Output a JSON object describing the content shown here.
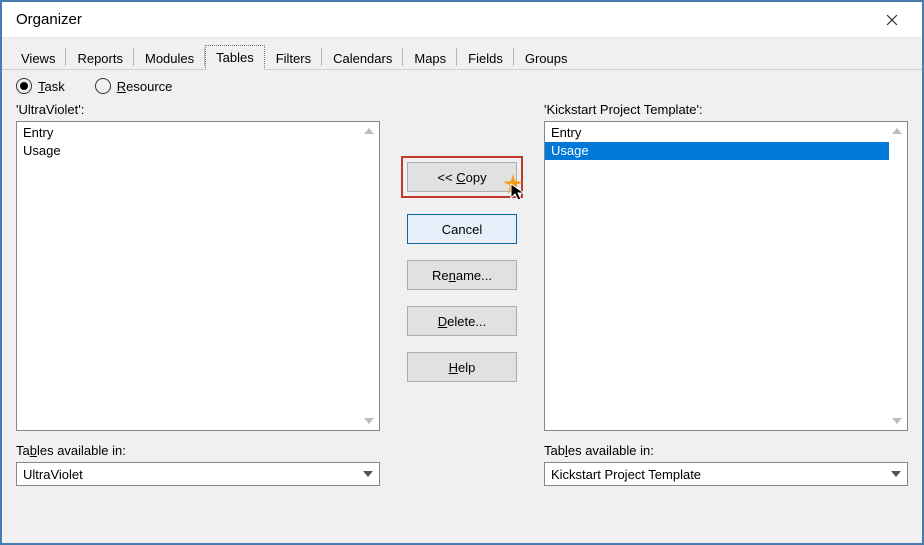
{
  "window": {
    "title": "Organizer"
  },
  "tabs": {
    "items": [
      "Views",
      "Reports",
      "Modules",
      "Tables",
      "Filters",
      "Calendars",
      "Maps",
      "Fields",
      "Groups"
    ],
    "active_index": 3
  },
  "type_radio": {
    "task": "Task",
    "resource": "Resource",
    "selected": "task"
  },
  "left": {
    "label": "'UltraViolet':",
    "items": [
      "Entry",
      "Usage"
    ],
    "selected_index": -1,
    "available_label": "Tables available in:",
    "combo_value": "UltraViolet"
  },
  "right": {
    "label": "'Kickstart Project Template':",
    "items": [
      "Entry",
      "Usage"
    ],
    "selected_index": 1,
    "available_label": "Tables available in:",
    "combo_value": "Kickstart Project Template"
  },
  "buttons": {
    "copy": "<< Copy",
    "cancel": "Cancel",
    "rename": "Rename...",
    "delete": "Delete...",
    "help": "Help"
  },
  "mnemonics": {
    "task_u": "T",
    "resource_u": "R",
    "tables_avail_left_u": "b",
    "tables_avail_right_u": "l",
    "copy_u": "C",
    "rename_u": "n",
    "delete_u": "D",
    "help_u": "H"
  }
}
